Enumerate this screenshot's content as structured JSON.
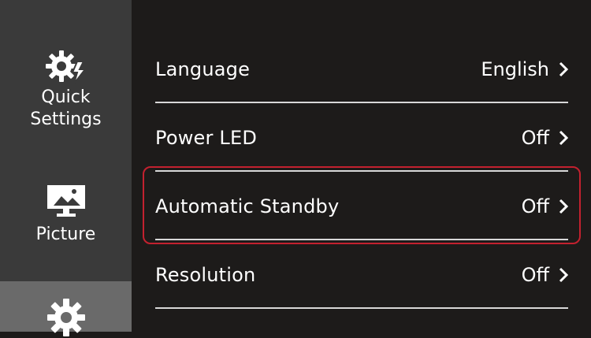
{
  "sidebar": {
    "items": [
      {
        "label": "Quick\nSettings",
        "icon": "gear-bolt-icon"
      },
      {
        "label": "Picture",
        "icon": "monitor-icon"
      },
      {
        "label": "",
        "icon": "gear-icon",
        "selected": true
      }
    ]
  },
  "menu": {
    "rows": [
      {
        "label": "Language",
        "value": "English"
      },
      {
        "label": "Power LED",
        "value": "Off"
      },
      {
        "label": "Automatic Standby",
        "value": "Off",
        "highlighted": true
      },
      {
        "label": "Resolution",
        "value": "Off"
      }
    ]
  },
  "colors": {
    "background": "#1d1b1a",
    "sidebar": "#3a3a3a",
    "sidebar_selected": "#6a6a6a",
    "highlight": "#c3212f",
    "text": "#ffffff"
  }
}
